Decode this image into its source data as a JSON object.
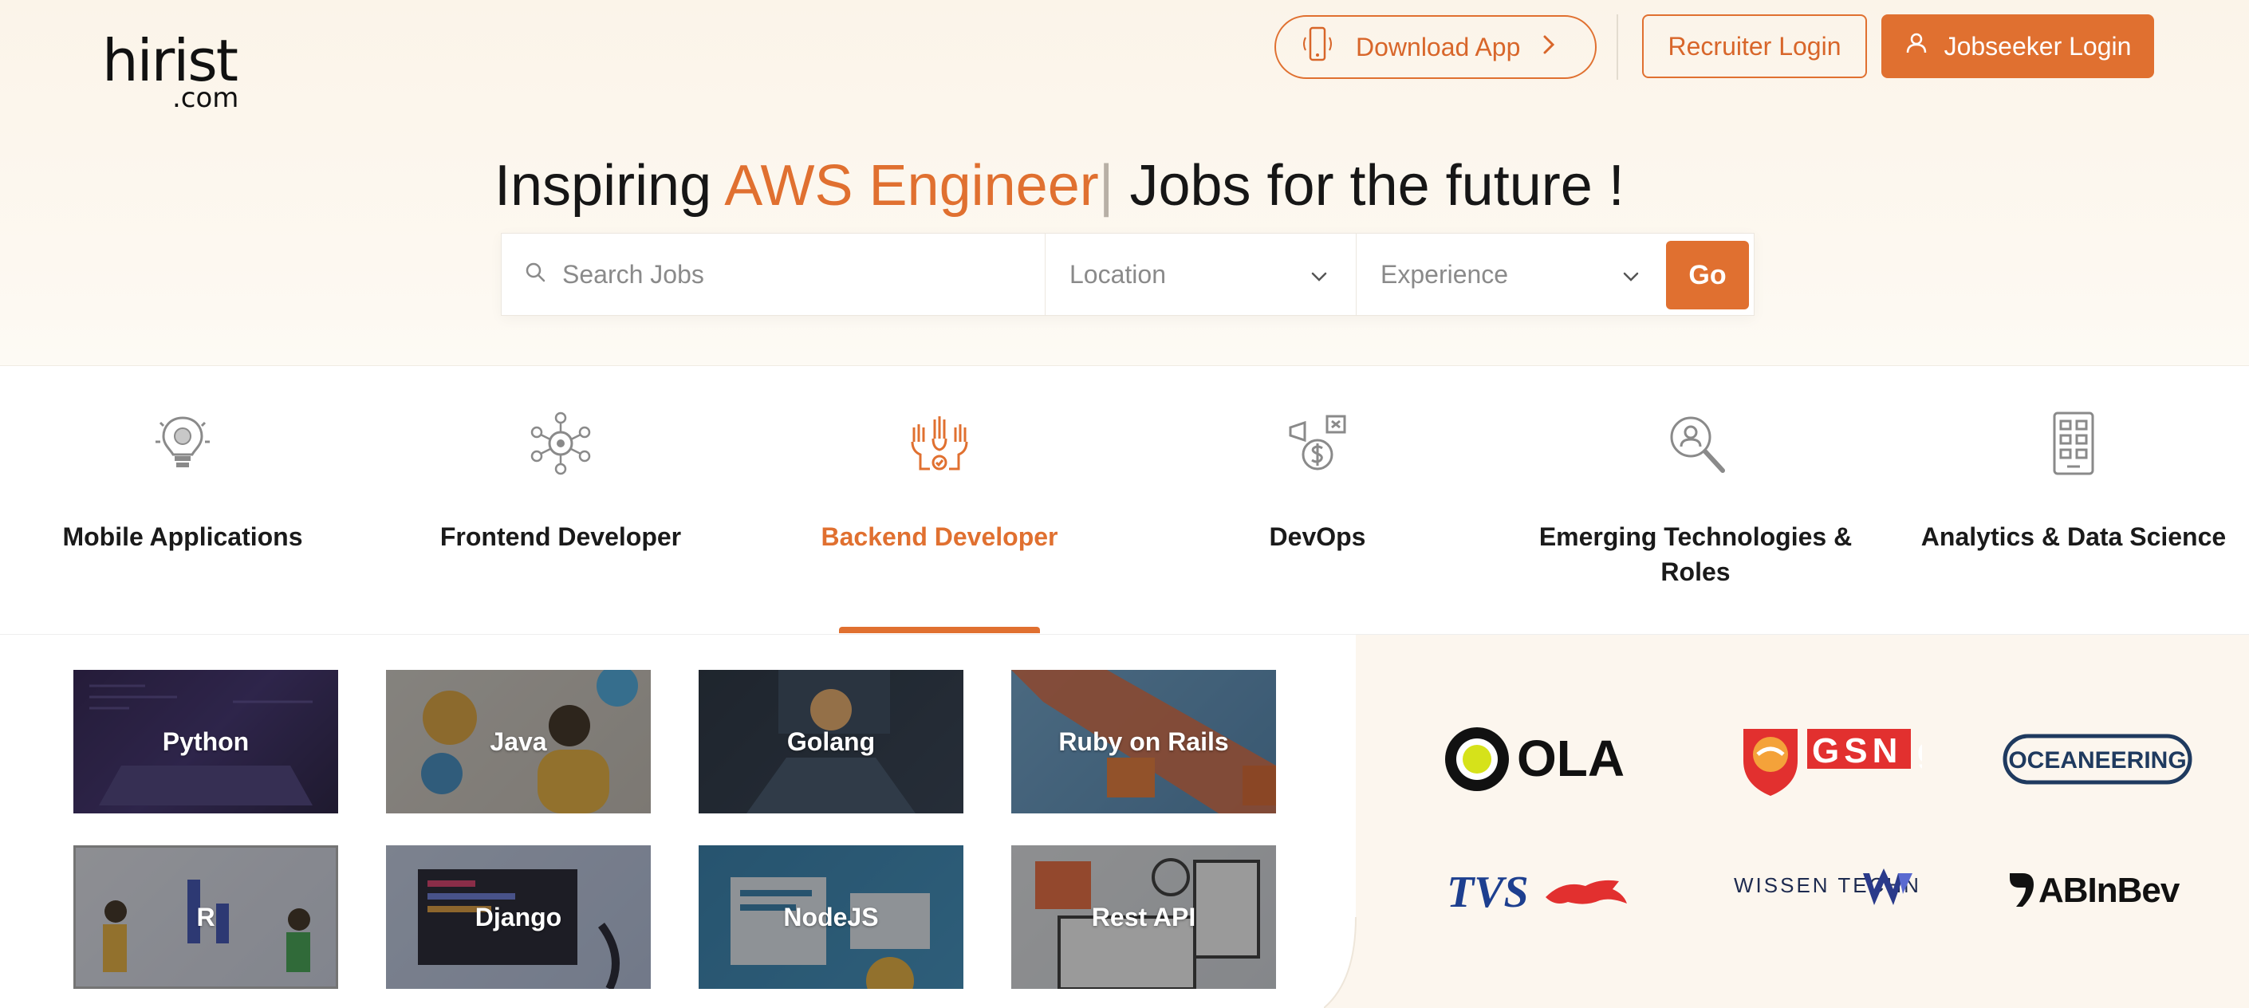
{
  "header": {
    "logo_main": "hirist",
    "logo_sub": ".com",
    "download_label": "Download App",
    "recruiter_label": "Recruiter Login",
    "jobseeker_label": "Jobseeker Login"
  },
  "hero": {
    "headline_prefix": "Inspiring ",
    "headline_accent": "AWS Engineer",
    "headline_caret": "|",
    "headline_suffix": " Jobs for the future !"
  },
  "search": {
    "placeholder": "Search Jobs",
    "location_label": "Location",
    "experience_label": "Experience",
    "go_label": "Go"
  },
  "categories": [
    {
      "label": "Mobile Applications",
      "icon": "bulb-brain-icon",
      "active": false
    },
    {
      "label": "Frontend Developer",
      "icon": "gear-network-icon",
      "active": false
    },
    {
      "label": "Backend Developer",
      "icon": "hands-team-icon",
      "active": true
    },
    {
      "label": "DevOps",
      "icon": "money-megaphone-icon",
      "active": false
    },
    {
      "label": "Emerging Technologies & Roles",
      "icon": "search-person-icon",
      "active": false
    },
    {
      "label": "Analytics & Data Science",
      "icon": "tablet-grid-icon",
      "active": false
    }
  ],
  "tiles": [
    {
      "label": "Python"
    },
    {
      "label": "Java"
    },
    {
      "label": "Golang"
    },
    {
      "label": "Ruby on Rails"
    },
    {
      "label": "R"
    },
    {
      "label": "Django"
    },
    {
      "label": "NodeJS"
    },
    {
      "label": "Rest API"
    }
  ],
  "companies": [
    {
      "name": "OLA"
    },
    {
      "name": "GSN games"
    },
    {
      "name": "OCEANEERING"
    },
    {
      "name": "TVS"
    },
    {
      "name": "WISSEN TECHNOLOGY"
    },
    {
      "name": "ABInBev"
    }
  ],
  "colors": {
    "accent": "#e07030",
    "hero_bg": "#fbf4e9",
    "panel_bg": "#fcf6ee"
  }
}
